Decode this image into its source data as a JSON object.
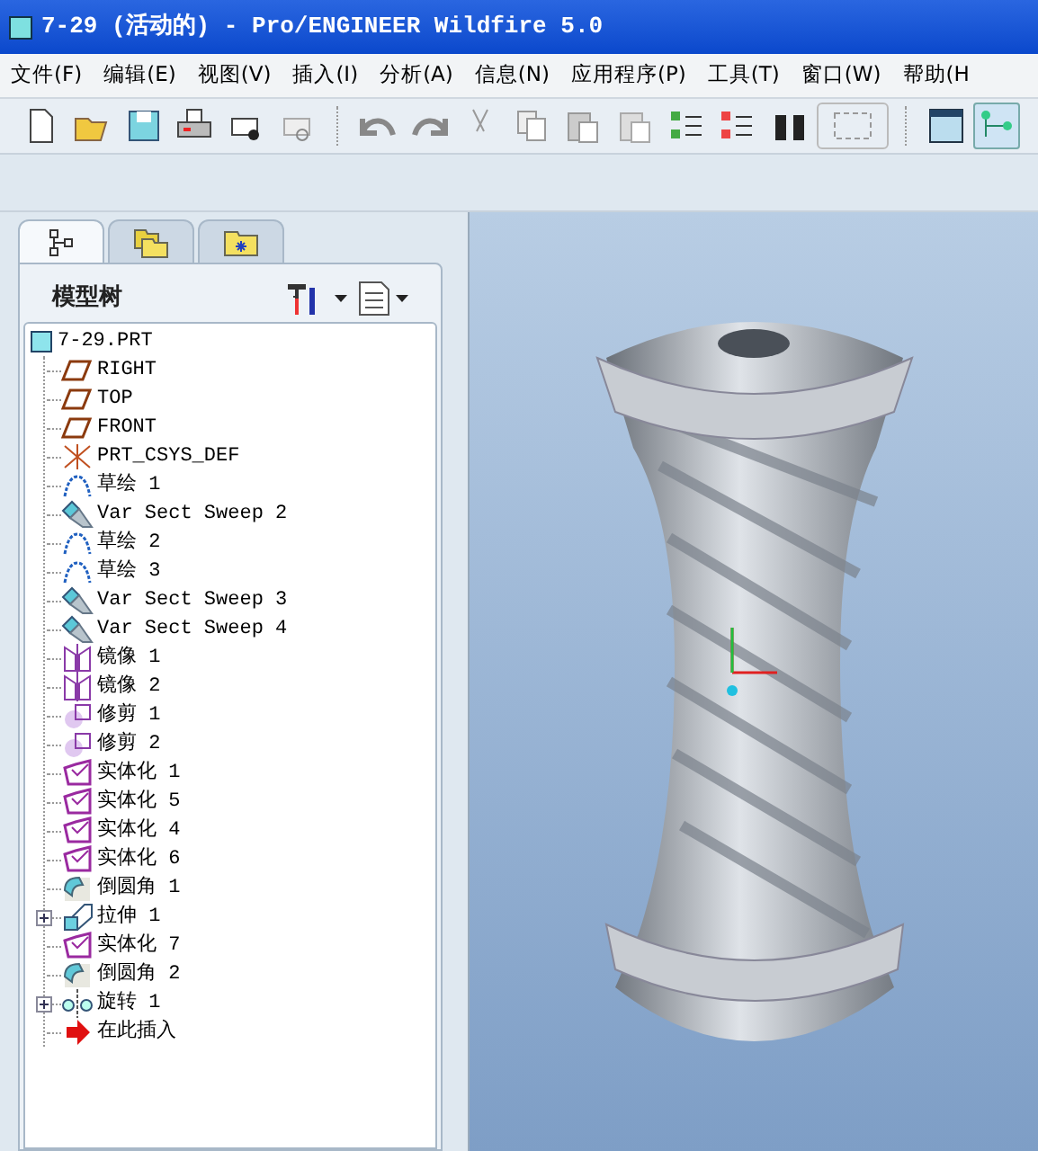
{
  "window": {
    "title": "7-29 (活动的) - Pro/ENGINEER Wildfire 5.0"
  },
  "menu": [
    "文件(F)",
    "编辑(E)",
    "视图(V)",
    "插入(I)",
    "分析(A)",
    "信息(N)",
    "应用程序(P)",
    "工具(T)",
    "窗口(W)",
    "帮助(H"
  ],
  "navigator_tabs": [
    {
      "kind": "tree",
      "selected": true
    },
    {
      "kind": "folders",
      "selected": false
    },
    {
      "kind": "favorites",
      "selected": false
    }
  ],
  "model_tree": {
    "title": "模型树",
    "root": "7-29.PRT",
    "items": [
      {
        "kind": "plane",
        "label": "RIGHT",
        "collapsed": false
      },
      {
        "kind": "plane",
        "label": "TOP",
        "collapsed": false
      },
      {
        "kind": "plane",
        "label": "FRONT",
        "collapsed": false
      },
      {
        "kind": "csys",
        "label": "PRT_CSYS_DEF",
        "collapsed": false
      },
      {
        "kind": "sketch",
        "label": "草绘 1",
        "collapsed": false
      },
      {
        "kind": "sweep",
        "label": "Var Sect Sweep 2",
        "collapsed": false
      },
      {
        "kind": "sketch",
        "label": "草绘 2",
        "collapsed": false
      },
      {
        "kind": "sketch",
        "label": "草绘 3",
        "collapsed": false
      },
      {
        "kind": "sweep",
        "label": "Var Sect Sweep 3",
        "collapsed": false
      },
      {
        "kind": "sweep",
        "label": "Var Sect Sweep 4",
        "collapsed": false
      },
      {
        "kind": "mirror",
        "label": "镜像 1",
        "collapsed": false
      },
      {
        "kind": "mirror",
        "label": "镜像 2",
        "collapsed": false
      },
      {
        "kind": "trim",
        "label": "修剪 1",
        "collapsed": false
      },
      {
        "kind": "trim",
        "label": "修剪 2",
        "collapsed": false
      },
      {
        "kind": "solidify",
        "label": "实体化 1",
        "collapsed": false
      },
      {
        "kind": "solidify",
        "label": "实体化 5",
        "collapsed": false
      },
      {
        "kind": "solidify",
        "label": "实体化 4",
        "collapsed": false
      },
      {
        "kind": "solidify",
        "label": "实体化 6",
        "collapsed": false
      },
      {
        "kind": "round",
        "label": "倒圆角 1",
        "collapsed": false
      },
      {
        "kind": "extrude",
        "label": "拉伸 1",
        "collapsed": true
      },
      {
        "kind": "solidify",
        "label": "实体化 7",
        "collapsed": false
      },
      {
        "kind": "round",
        "label": "倒圆角 2",
        "collapsed": false
      },
      {
        "kind": "revolve",
        "label": "旋转 1",
        "collapsed": true
      },
      {
        "kind": "insert",
        "label": "在此插入",
        "collapsed": false
      }
    ]
  }
}
